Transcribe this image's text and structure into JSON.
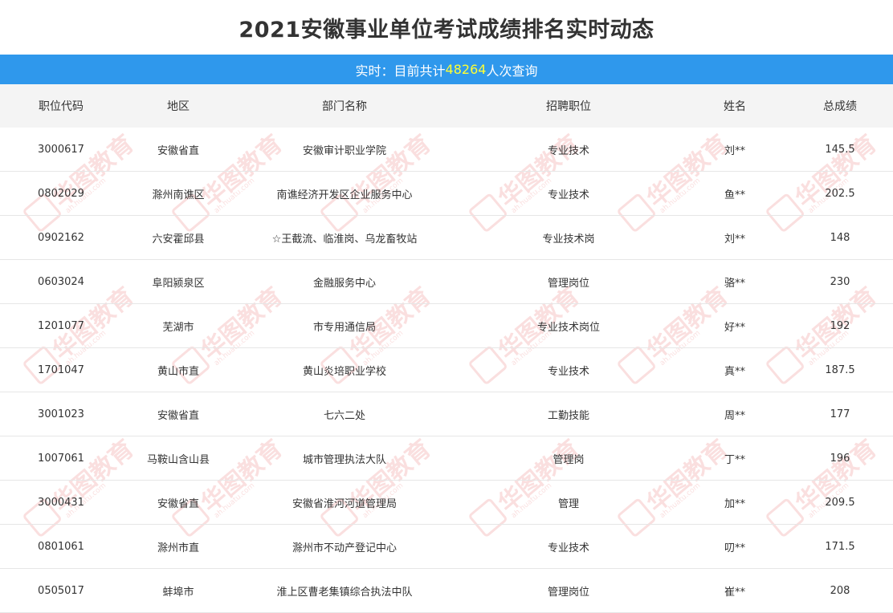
{
  "page": {
    "title": "2021安徽事业单位考试成绩排名实时动态"
  },
  "banner": {
    "prefix": "实时：目前共计",
    "count": "48264",
    "suffix": "人次查询",
    "bg_color": "#2f98ec",
    "count_color": "#ffff33"
  },
  "table": {
    "headers": [
      "职位代码",
      "地区",
      "部门名称",
      "招聘职位",
      "姓名",
      "总成绩"
    ],
    "rows": [
      [
        "3000617",
        "安徽省直",
        "安徽审计职业学院",
        "专业技术",
        "刘**",
        "145.5"
      ],
      [
        "0802029",
        "滁州南谯区",
        "南谯经济开发区企业服务中心",
        "专业技术",
        "鱼**",
        "202.5"
      ],
      [
        "0902162",
        "六安霍邱县",
        "☆王截流、临淮岗、乌龙畜牧站",
        "专业技术岗",
        "刘**",
        "148"
      ],
      [
        "0603024",
        "阜阳颍泉区",
        "金融服务中心",
        "管理岗位",
        "骆**",
        "230"
      ],
      [
        "1201077",
        "芜湖市",
        "市专用通信局",
        "专业技术岗位",
        "好**",
        "192"
      ],
      [
        "1701047",
        "黄山市直",
        "黄山炎培职业学校",
        "专业技术",
        "真**",
        "187.5"
      ],
      [
        "3001023",
        "安徽省直",
        "七六二处",
        "工勤技能",
        "周**",
        "177"
      ],
      [
        "1007061",
        "马鞍山含山县",
        "城市管理执法大队",
        "管理岗",
        "丁**",
        "196"
      ],
      [
        "3000431",
        "安徽省直",
        "安徽省淮河河道管理局",
        "管理",
        "加**",
        "209.5"
      ],
      [
        "0801061",
        "滁州市直",
        "滁州市不动产登记中心",
        "专业技术",
        "叨**",
        "171.5"
      ],
      [
        "0505017",
        "蚌埠市",
        "淮上区曹老集镇综合执法中队",
        "管理岗位",
        "崔**",
        "208"
      ]
    ]
  },
  "watermark": {
    "text": "华图教育",
    "url": "ah.huatu.com",
    "color": "#dd2222"
  }
}
